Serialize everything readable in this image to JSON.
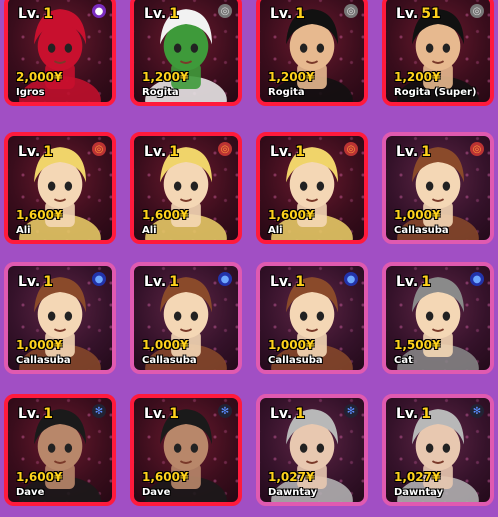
{
  "units": [
    {
      "level_label": "Lv.",
      "level": "1",
      "price": "2,000¥",
      "name": "Igros",
      "element": "purple-orb",
      "frame": "red",
      "hair": "#c8102e",
      "skin": "#c8102e"
    },
    {
      "level_label": "Lv.",
      "level": "1",
      "price": "1,200¥",
      "name": "Rogita",
      "element": "gray-ring",
      "frame": "red",
      "hair": "#f2f2f2",
      "skin": "#3e9a3a"
    },
    {
      "level_label": "Lv.",
      "level": "1",
      "price": "1,200¥",
      "name": "Rogita",
      "element": "gray-ring",
      "frame": "red",
      "hair": "#111111",
      "skin": "#e7b98f"
    },
    {
      "level_label": "Lv.",
      "level": "51",
      "price": "1,200¥",
      "name": "Rogita (Super)",
      "element": "gray-ring",
      "frame": "red",
      "hair": "#111111",
      "skin": "#e7b98f"
    },
    {
      "level_label": "Lv.",
      "level": "1",
      "price": "1,600¥",
      "name": "Ali",
      "element": "orange-ring",
      "frame": "red",
      "hair": "#f0d46a",
      "skin": "#f4d7b5"
    },
    {
      "level_label": "Lv.",
      "level": "1",
      "price": "1,600¥",
      "name": "Ali",
      "element": "orange-ring",
      "frame": "red",
      "hair": "#f0d46a",
      "skin": "#f4d7b5"
    },
    {
      "level_label": "Lv.",
      "level": "1",
      "price": "1,600¥",
      "name": "Ali",
      "element": "orange-ring",
      "frame": "red",
      "hair": "#f0d46a",
      "skin": "#f4d7b5"
    },
    {
      "level_label": "Lv.",
      "level": "1",
      "price": "1,000¥",
      "name": "Callasuba",
      "element": "orange-ring",
      "frame": "pink",
      "hair": "#8a4a2a",
      "skin": "#f4d7b5"
    },
    {
      "level_label": "Lv.",
      "level": "1",
      "price": "1,000¥",
      "name": "Callasuba",
      "element": "blue-orb",
      "frame": "pink",
      "hair": "#8a4a2a",
      "skin": "#f4d7b5"
    },
    {
      "level_label": "Lv.",
      "level": "1",
      "price": "1,000¥",
      "name": "Callasuba",
      "element": "blue-orb",
      "frame": "pink",
      "hair": "#8a4a2a",
      "skin": "#f4d7b5"
    },
    {
      "level_label": "Lv.",
      "level": "1",
      "price": "1,000¥",
      "name": "Callasuba",
      "element": "blue-orb",
      "frame": "pink",
      "hair": "#8a4a2a",
      "skin": "#f4d7b5"
    },
    {
      "level_label": "Lv.",
      "level": "1",
      "price": "1,500¥",
      "name": "Cat",
      "element": "blue-orb",
      "frame": "pink",
      "hair": "#8a8a8a",
      "skin": "#f4d7b5"
    },
    {
      "level_label": "Lv.",
      "level": "1",
      "price": "1,600¥",
      "name": "Dave",
      "element": "blue-ring",
      "frame": "red",
      "hair": "#1a1a1a",
      "skin": "#b8876a"
    },
    {
      "level_label": "Lv.",
      "level": "1",
      "price": "1,600¥",
      "name": "Dave",
      "element": "blue-ring",
      "frame": "red",
      "hair": "#1a1a1a",
      "skin": "#b8876a"
    },
    {
      "level_label": "Lv.",
      "level": "1",
      "price": "1,027¥",
      "name": "Dawntay",
      "element": "blue-ring",
      "frame": "pink",
      "hair": "#b8b8b8",
      "skin": "#e8c8b0"
    },
    {
      "level_label": "Lv.",
      "level": "1",
      "price": "1,027¥",
      "name": "Dawntay",
      "element": "blue-ring",
      "frame": "pink",
      "hair": "#b8b8b8",
      "skin": "#e8c8b0"
    }
  ]
}
